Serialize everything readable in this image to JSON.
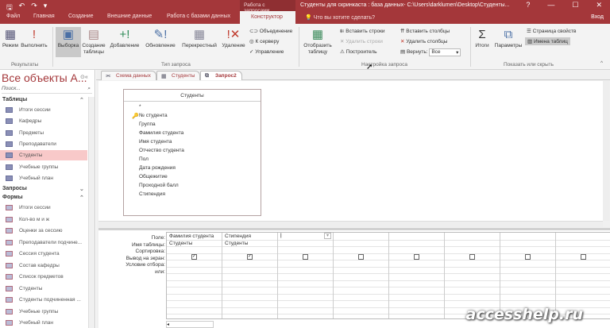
{
  "window": {
    "title": "Студенты для скринкаста : база данных- C:\\Users\\darklumen\\Desktop\\Студенты...",
    "context_tab": "Работа с запросами",
    "help": "?",
    "minimize": "—",
    "maximize": "☐",
    "close": "✕"
  },
  "qat": {
    "save": "🖫",
    "undo": "↶",
    "redo": "↷",
    "more": "▾"
  },
  "tabs": [
    "Файл",
    "Главная",
    "Создание",
    "Внешние данные",
    "Работа с базами данных",
    "Конструктор"
  ],
  "tell_me": "Что вы хотите сделать?",
  "sign_in": "Вход",
  "ribbon": {
    "results": {
      "label": "Результаты",
      "mode": "Режим",
      "run": "Выполнить"
    },
    "query_type": {
      "label": "Тип запроса",
      "select": "Выборка",
      "make_table": "Создание таблицы",
      "append": "Добавление",
      "update": "Обновление",
      "crosstab": "Перекрестный",
      "delete": "Удаление",
      "union": "Объединение",
      "passthrough": "К серверу",
      "ddl": "Управление"
    },
    "setup": {
      "label": "Настройка запроса",
      "show_table": "Отобразить таблицу",
      "insert_rows": "Вставить строки",
      "delete_rows": "Удалить строки",
      "builder": "Построитель",
      "insert_cols": "Вставить столбцы",
      "delete_cols": "Удалить столбцы",
      "return": "Вернуть:",
      "return_value": "Все"
    },
    "show_hide": {
      "label": "Показать или скрыть",
      "totals": "Итоги",
      "params": "Параметры",
      "property_sheet": "Страница свойств",
      "table_names": "Имена таблиц"
    }
  },
  "nav": {
    "title": "Все объекты A...",
    "search_placeholder": "Поиск...",
    "sections": {
      "tables": "Таблицы",
      "queries": "Запросы",
      "forms": "Формы"
    },
    "tables": [
      "Итоги сессии",
      "Кафедры",
      "Предметы",
      "Преподаватели",
      "Студенты",
      "Учебные группы",
      "Учебный план"
    ],
    "forms": [
      "Итоги сессии",
      "Кол-во м и ж",
      "Оценки за сессию",
      "Преподаватели подчине...",
      "Сессия студента",
      "Состав кафедры",
      "Список предметов",
      "Студенты",
      "Студенты подчиненная ...",
      "Учебные группы",
      "Учебный план"
    ]
  },
  "doc_tabs": [
    "Схема данных",
    "Студенты",
    "Запрос2"
  ],
  "table_box": {
    "title": "Студенты",
    "fields": [
      "*",
      "№ студента",
      "Группа",
      "Фамилия студента",
      "Имя студента",
      "Отчество студента",
      "Пол",
      "Дата рождения",
      "Общежитие",
      "Проходной балл",
      "Стипендия"
    ]
  },
  "grid": {
    "row_labels": [
      "Поле:",
      "Имя таблицы:",
      "Сортировка:",
      "Вывод на экран:",
      "Условие отбора:",
      "или:"
    ],
    "columns": [
      {
        "field": "Фамилия студента",
        "table": "Студенты",
        "show": true
      },
      {
        "field": "Стипендия",
        "table": "Студенты",
        "show": true
      },
      {
        "field": "",
        "table": "",
        "show": false
      },
      {
        "field": "",
        "table": "",
        "show": false
      },
      {
        "field": "",
        "table": "",
        "show": false
      },
      {
        "field": "",
        "table": "",
        "show": false
      },
      {
        "field": "",
        "table": "",
        "show": false
      },
      {
        "field": "",
        "table": "",
        "show": false
      }
    ]
  },
  "watermark": "accesshelp.ru"
}
